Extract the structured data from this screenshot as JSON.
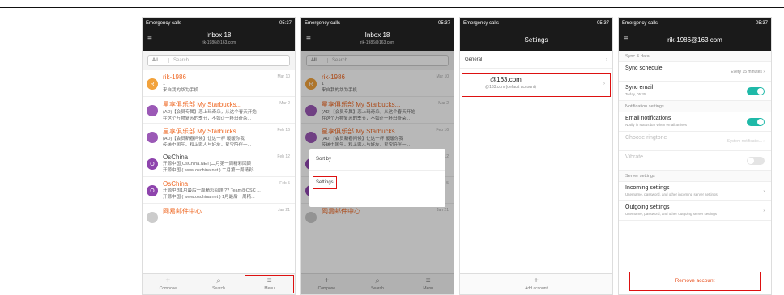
{
  "status": {
    "s1_left": "Emergency calls",
    "s2_left": "Emergency calls",
    "s3_left": "Emergency calls",
    "s4_left": "Emergency calls",
    "right": "05:37",
    "icons": [
      "sim-icon",
      "alarm-icon",
      "wifi-icon",
      "signal-icon",
      "battery-icon"
    ]
  },
  "inbox": {
    "title": "Inbox",
    "count": "18",
    "account": "rik-1986@163.com",
    "filter": "All",
    "search_placeholder": "Search",
    "mails": [
      {
        "avatar": "R",
        "avatar_color": "#f2a23c",
        "sender": "rik-1986",
        "date": "Mar 10",
        "line1": "1",
        "line2": "来自我的华为手机",
        "unread": true
      },
      {
        "avatar": "",
        "avatar_color": "#9b59b6",
        "sender": "星享俱乐部 My Starbucks...",
        "date": "Mar 2",
        "line1": "(AD)【会员专属】恋上玛奇朵，从这个春天开始",
        "line2": "在这个万物复苏的季节，不如让一杯玛奇朵...",
        "unread": true
      },
      {
        "avatar": "",
        "avatar_color": "#9b59b6",
        "sender": "星享俱乐部 My Starbucks...",
        "date": "Feb 16",
        "line1": "(AD)【会员新春问候】让这一杯 暖暖你我",
        "line2": "传统中国年，和上家人与好友，星宝陪伴一...",
        "unread": true
      },
      {
        "avatar": "O",
        "avatar_color": "#8e44ad",
        "sender": "OsChina",
        "date": "Feb 12",
        "line1": "开源中国(OsChina.NET)二月第一周精彩回顾",
        "line2": "开源中国 ( www.oschina.net ) 二月第一周精彩...",
        "unread": false
      },
      {
        "avatar": "O",
        "avatar_color": "#8e44ad",
        "sender": "OsChina",
        "date": "Feb 5",
        "line1": "开源中国1月最后一周精彩回顾 ?? Team@OSC ...",
        "line2": "开源中国 ( www.oschina.net ) 1月最后一周精...",
        "unread": true
      },
      {
        "avatar": "",
        "avatar_color": "#cccccc",
        "sender": "网易邮件中心",
        "date": "Jan 21",
        "line1": "",
        "line2": "",
        "unread": true
      }
    ]
  },
  "bottom_tabs": [
    {
      "icon": "plus-icon",
      "glyph": "+",
      "label": "Compose"
    },
    {
      "icon": "search-icon",
      "glyph": "⌕",
      "label": "Search"
    },
    {
      "icon": "menu-icon",
      "glyph": "≡",
      "label": "Menu"
    }
  ],
  "menu_sheet": {
    "sort_by": "Sort by",
    "settings": "Settings"
  },
  "settings_screen": {
    "title": "Settings",
    "general": "General",
    "account_email": "@163.com",
    "account_default": "@163.com (default account)",
    "add_account": "Add account"
  },
  "account_settings": {
    "title": "rik-1986@163.com",
    "section_sync": "Sync & data",
    "sync_schedule": "Sync schedule",
    "sync_schedule_value": "Every 15 minutes",
    "sync_email": "Sync email",
    "sync_email_sub": "Today, 05:35",
    "section_notification": "Notification settings",
    "email_notifications": "Email notifications",
    "email_notifications_sub": "Notify in status bar when email arrives",
    "choose_ringtone": "Choose ringtone",
    "choose_ringtone_value": "System notificatio...",
    "vibrate": "Vibrate",
    "section_server": "Server settings",
    "incoming": "Incoming settings",
    "incoming_sub": "Username, password, and other incoming server settings",
    "outgoing": "Outgoing settings",
    "outgoing_sub": "Username, password, and other outgoing server settings",
    "remove": "Remove account"
  },
  "colors": {
    "accent": "#ef6a26",
    "toggle": "#1fb9a8",
    "highlight": "#dd1111"
  }
}
